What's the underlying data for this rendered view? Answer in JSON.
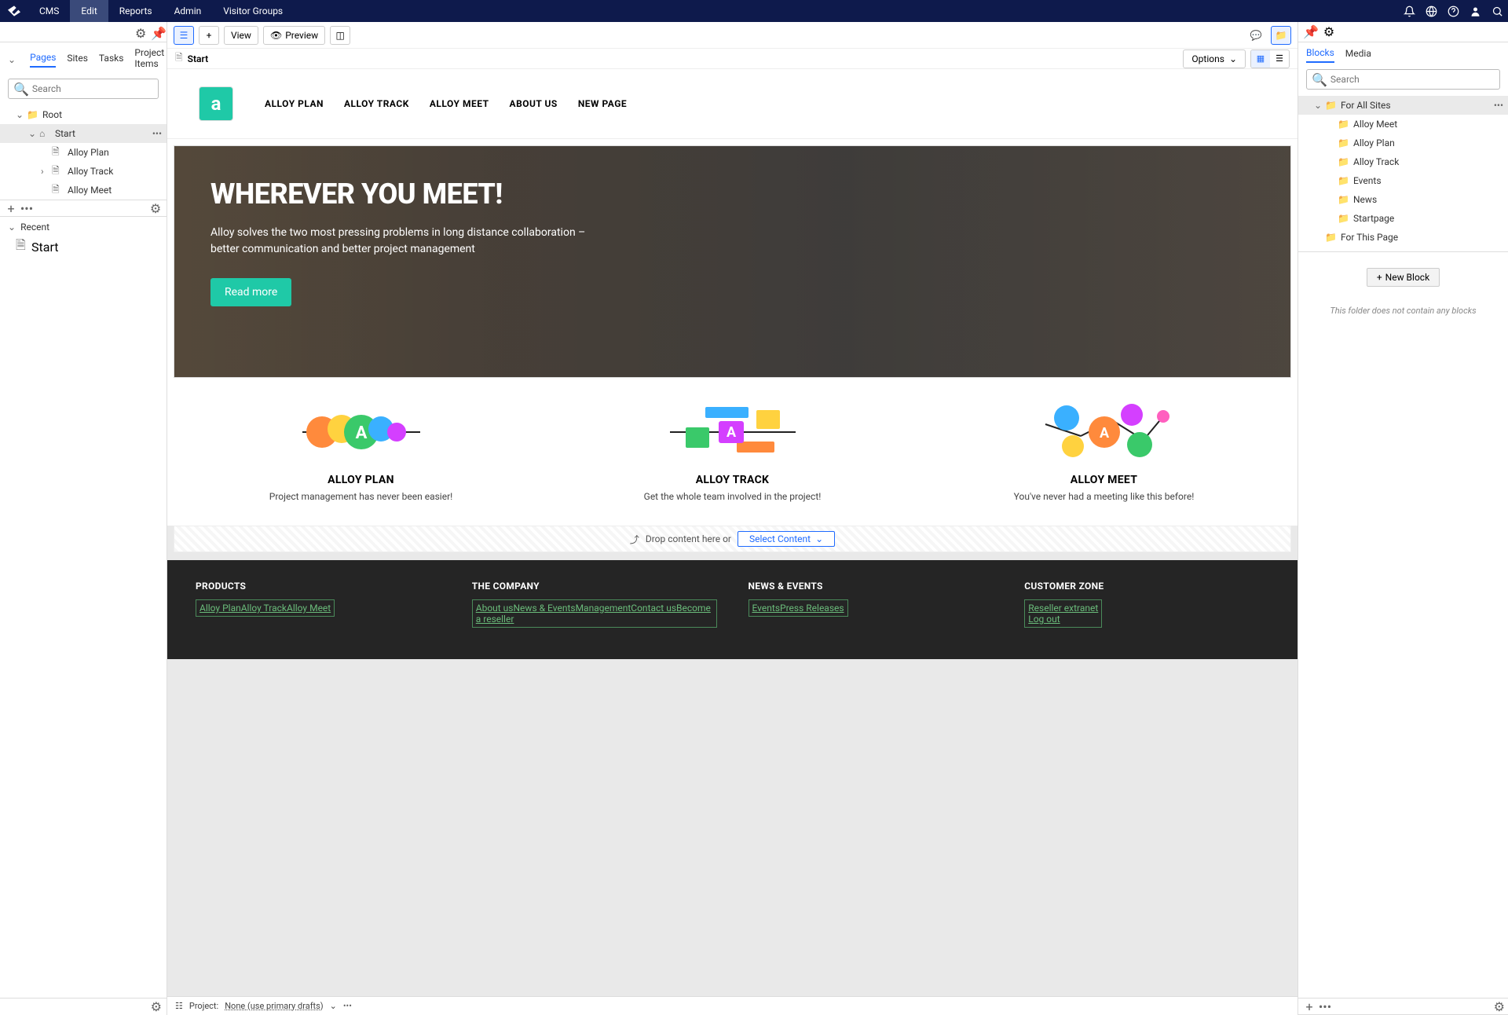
{
  "topnav": {
    "items": [
      "CMS",
      "Edit",
      "Reports",
      "Admin",
      "Visitor Groups"
    ],
    "active_index": 1
  },
  "left_panel": {
    "tabs": [
      "Pages",
      "Sites",
      "Tasks",
      "Project Items"
    ],
    "search_placeholder": "Search",
    "tree": {
      "root_label": "Root",
      "start_label": "Start",
      "children": [
        "Alloy Plan",
        "Alloy Track",
        "Alloy Meet"
      ]
    },
    "recent_header": "Recent",
    "recent_items": [
      "Start"
    ]
  },
  "toolbar": {
    "view_label": "View",
    "preview_label": "Preview"
  },
  "breadcrumb": {
    "current": "Start",
    "options_label": "Options"
  },
  "site": {
    "nav": [
      "ALLOY PLAN",
      "ALLOY TRACK",
      "ALLOY MEET",
      "ABOUT US",
      "NEW PAGE"
    ],
    "hero": {
      "title": "WHEREVER YOU MEET!",
      "subtitle": "Alloy solves the two most pressing problems in long distance collaboration – better communication and better project management",
      "cta": "Read more"
    },
    "cards": [
      {
        "title": "ALLOY PLAN",
        "desc": "Project management has never been easier!"
      },
      {
        "title": "ALLOY TRACK",
        "desc": "Get the whole team involved in the project!"
      },
      {
        "title": "ALLOY MEET",
        "desc": "You've never had a meeting like this before!"
      }
    ],
    "drop_text": "Drop content here or",
    "select_content": "Select Content"
  },
  "footer": {
    "cols": [
      {
        "title": "PRODUCTS",
        "links": [
          "Alloy Plan",
          "Alloy Track",
          "Alloy Meet"
        ]
      },
      {
        "title": "THE COMPANY",
        "links": [
          "About us",
          "News & Events",
          "Management",
          "Contact us",
          "Become a reseller"
        ]
      },
      {
        "title": "NEWS & EVENTS",
        "links": [
          "Events",
          "Press Releases"
        ]
      },
      {
        "title": "CUSTOMER ZONE",
        "links": [
          "Reseller extranet",
          "Log out"
        ]
      }
    ]
  },
  "right_panel": {
    "tabs": [
      "Blocks",
      "Media"
    ],
    "search_placeholder": "Search",
    "tree": {
      "root": "For All Sites",
      "children": [
        "Alloy Meet",
        "Alloy Plan",
        "Alloy Track",
        "Events",
        "News",
        "Startpage"
      ],
      "this_page": "For This Page"
    },
    "new_block": "New Block",
    "empty_msg": "This folder does not contain any blocks"
  },
  "statusbar": {
    "project_label": "Project:",
    "project_value": "None (use primary drafts)"
  }
}
